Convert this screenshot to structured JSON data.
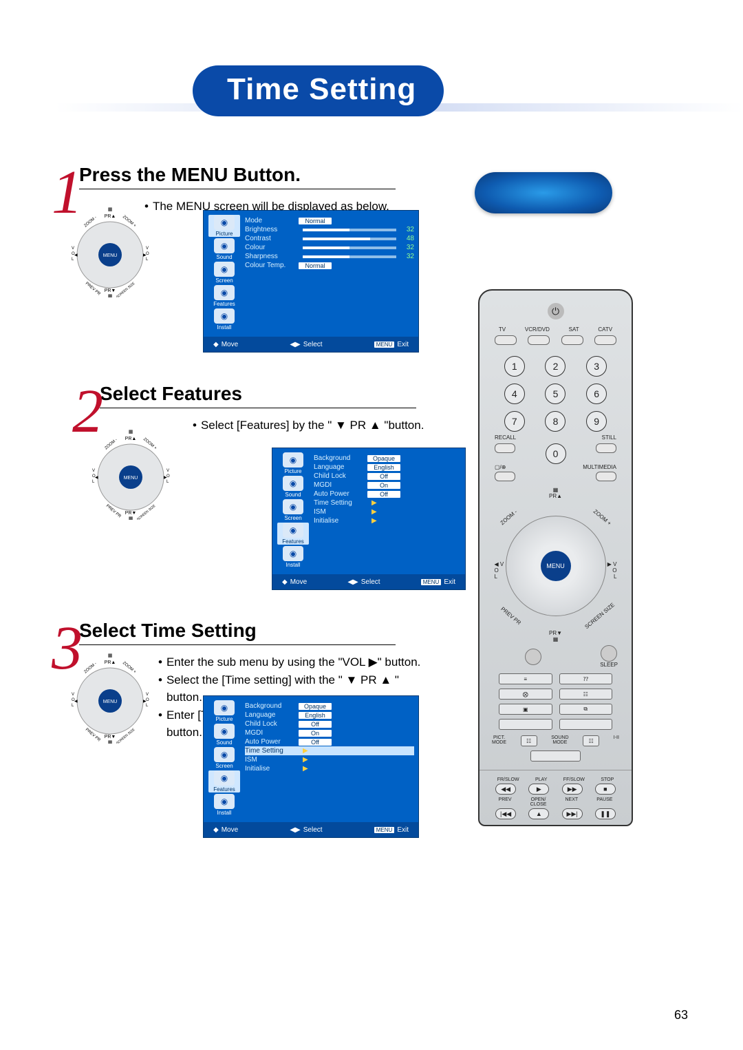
{
  "page_number": "63",
  "title": "Time Setting",
  "steps": [
    {
      "num": "1",
      "title": "Press the MENU Button.",
      "bullets": [
        "The MENU screen will be displayed as below."
      ]
    },
    {
      "num": "2",
      "title": "Select Features",
      "bullets": [
        "Select [Features] by the \" ▼ PR ▲ \"button."
      ]
    },
    {
      "num": "3",
      "title": "Select Time Setting",
      "bullets": [
        "Enter the sub menu by using the \"VOL ▶\" button.",
        "Select the [Time setting] with the \" ▼ PR ▲ \" button.",
        "Enter [Time Setting] by pressing the  \"VOL▶\" button."
      ]
    }
  ],
  "menu_sidebar": [
    "Picture",
    "Sound",
    "Screen",
    "Features",
    "Install"
  ],
  "menu1_rows": [
    {
      "label": "Mode",
      "value": "Normal",
      "type": "box"
    },
    {
      "label": "Brightness",
      "value": "32",
      "type": "slider",
      "fill": 50
    },
    {
      "label": "Contrast",
      "value": "48",
      "type": "slider",
      "fill": 72
    },
    {
      "label": "Colour",
      "value": "32",
      "type": "slider",
      "fill": 50
    },
    {
      "label": "Sharpness",
      "value": "32",
      "type": "slider",
      "fill": 50
    },
    {
      "label": "Colour Temp.",
      "value": "Normal",
      "type": "box"
    }
  ],
  "menu2_rows": [
    {
      "label": "Background",
      "value": "Opaque",
      "type": "box"
    },
    {
      "label": "Language",
      "value": "English",
      "type": "box"
    },
    {
      "label": "Child Lock",
      "value": "Off",
      "type": "box"
    },
    {
      "label": "MGDI",
      "value": "On",
      "type": "box"
    },
    {
      "label": "Auto Power",
      "value": "Off",
      "type": "box"
    },
    {
      "label": "Time Setting",
      "value": "▶",
      "type": "arrow"
    },
    {
      "label": "ISM",
      "value": "▶",
      "type": "arrow"
    },
    {
      "label": "Initialise",
      "value": "▶",
      "type": "arrow"
    }
  ],
  "menu3_rows": [
    {
      "label": "Background",
      "value": "Opaque",
      "type": "box"
    },
    {
      "label": "Language",
      "value": "English",
      "type": "box"
    },
    {
      "label": "Child Lock",
      "value": "Off",
      "type": "box"
    },
    {
      "label": "MGDI",
      "value": "On",
      "type": "box"
    },
    {
      "label": "Auto Power",
      "value": "Off",
      "type": "box"
    },
    {
      "label": "Time Setting",
      "value": "▶",
      "type": "arrow",
      "highlight": true
    },
    {
      "label": "ISM",
      "value": "▶",
      "type": "arrow"
    },
    {
      "label": "Initialise",
      "value": "▶",
      "type": "arrow"
    }
  ],
  "menu_footer": {
    "move": "Move",
    "select": "Select",
    "exit": "Exit",
    "menu": "MENU"
  },
  "remote": {
    "sources": [
      "TV",
      "VCR/DVD",
      "SAT",
      "CATV"
    ],
    "numbers": [
      "1",
      "2",
      "3",
      "4",
      "5",
      "6",
      "7",
      "8",
      "9",
      "0"
    ],
    "recall": "RECALL",
    "still": "STILL",
    "multimedia": "MULTIMEDIA",
    "pr_up": "PR▲",
    "pr_down": "PR▼",
    "zoom_minus": "ZOOM -",
    "zoom_plus": "ZOOM +",
    "vol": "VOL",
    "menu": "MENU",
    "prev_pr": "PREV PR",
    "screen_size": "SCREEN SIZE",
    "sleep": "SLEEP",
    "pict_mode": "PICT.\nMODE",
    "sound_mode": "SOUND\nMODE",
    "i_ii": "I-II",
    "transport1": [
      "FR/SLOW",
      "PLAY",
      "FF/SLOW",
      "STOP"
    ],
    "transport1_sym": [
      "◀◀",
      "▶",
      "▶▶",
      "■"
    ],
    "transport2": [
      "PREV",
      "OPEN/\nCLOSE",
      "NEXT",
      "PAUSE"
    ],
    "transport2_sym": [
      "|◀◀",
      "▲",
      "▶▶|",
      "❚❚"
    ]
  },
  "dpad_labels": {
    "pr_up": "PR▲",
    "pr_down": "PR▼",
    "menu": "MENU",
    "vol": "VOL",
    "zoom": "ZOOM",
    "prev_pr": "PREV PR",
    "screen": "SCREEN SIZE"
  }
}
